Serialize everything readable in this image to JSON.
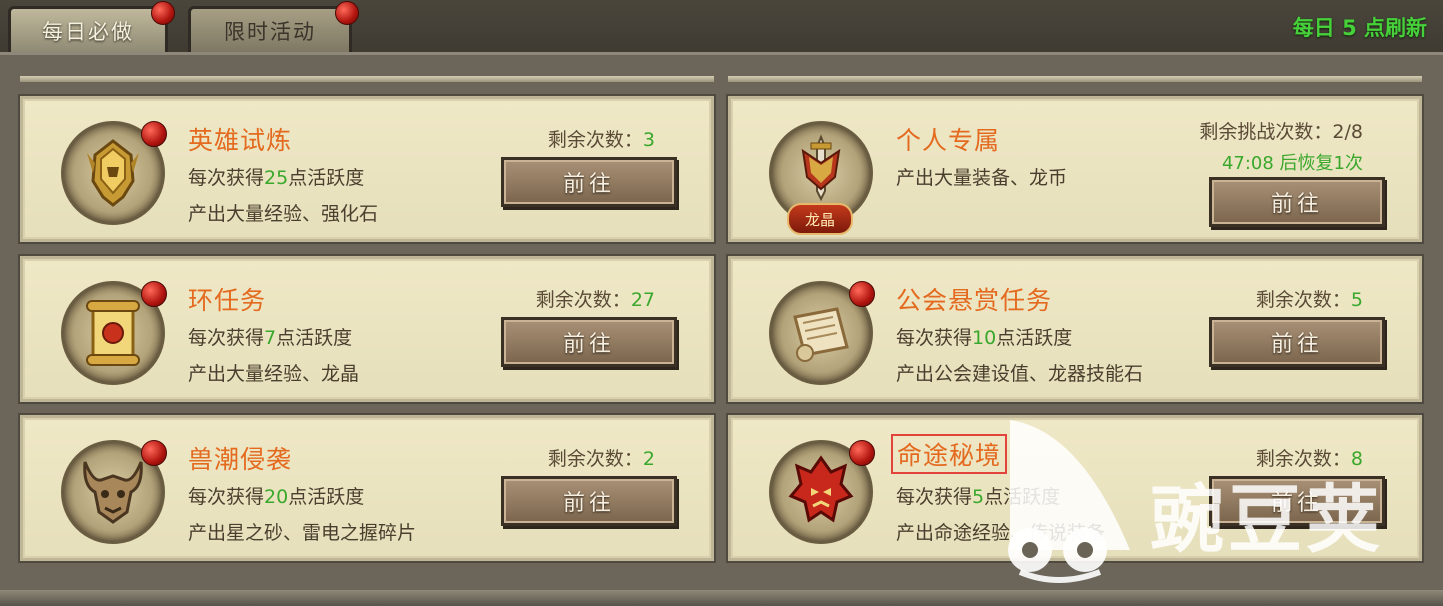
{
  "tabs": [
    {
      "label": "每日必做",
      "active": true,
      "has_dot": true
    },
    {
      "label": "限时活动",
      "active": false,
      "has_dot": true
    }
  ],
  "refresh_text": "每日 5 点刷新",
  "button_label": "前往",
  "cards": [
    {
      "title": "英雄试炼",
      "remain_label": "剩余次数：",
      "remain_value": "3",
      "line1_pre": "每次获得",
      "line1_num": "25",
      "line1_post": "点活跃度",
      "line2": "产出大量经验、强化石",
      "icon": "golden-helmet-icon"
    },
    {
      "title": "个人专属",
      "remain_label": "剩余挑战次数：",
      "remain_value": "2/8",
      "recover": "47:08 后恢复1次",
      "line1": "产出大量装备、龙币",
      "badge": "龙晶",
      "icon": "sword-crest-icon"
    },
    {
      "title": "环任务",
      "remain_label": "剩余次数：",
      "remain_value": "27",
      "line1_pre": "每次获得",
      "line1_num": "7",
      "line1_post": "点活跃度",
      "line2": "产出大量经验、龙晶",
      "icon": "scroll-icon"
    },
    {
      "title": "公会悬赏任务",
      "remain_label": "剩余次数：",
      "remain_value": "5",
      "line1_pre": "每次获得",
      "line1_num": "10",
      "line1_post": "点活跃度",
      "line2": "产出公会建设值、龙器技能石",
      "icon": "parchment-icon"
    },
    {
      "title": "兽潮侵袭",
      "remain_label": "剩余次数：",
      "remain_value": "2",
      "line1_pre": "每次获得",
      "line1_num": "20",
      "line1_post": "点活跃度",
      "line2": "产出星之砂、雷电之握碎片",
      "icon": "beast-mask-icon"
    },
    {
      "title": "命途秘境",
      "remain_label": "剩余次数：",
      "remain_value": "8",
      "line1_pre": "每次获得",
      "line1_num": "5",
      "line1_post": "点活跃度",
      "line2": "产出命途经验、传说装备",
      "icon": "demon-mask-icon"
    }
  ],
  "watermark": "豌豆荚",
  "colors": {
    "title": "#e36a1f",
    "highlight": "#3aa82c",
    "refresh": "#46d13a",
    "dot": "#b0140e"
  }
}
